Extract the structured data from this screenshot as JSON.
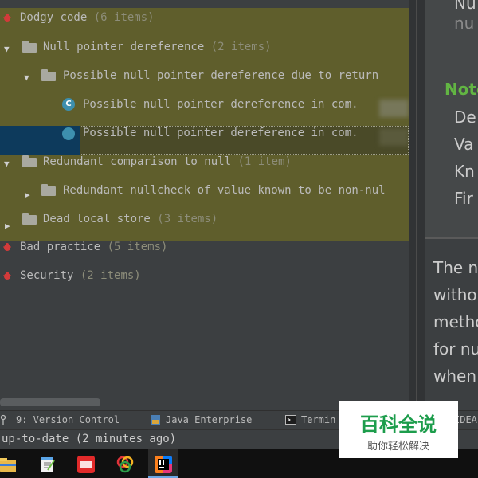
{
  "tree": {
    "rows": [
      {
        "label": "Dodgy code",
        "count": "(6 items)"
      },
      {
        "label": "Null pointer dereference",
        "count": "(2 items)"
      },
      {
        "label": "Possible null pointer dereference due to return"
      },
      {
        "label": "Possible null pointer dereference in com."
      },
      {
        "label": "Possible null pointer dereference in com."
      },
      {
        "label": "Redundant comparison to null",
        "count": "(1 item)"
      },
      {
        "label": "Redundant nullcheck of value known to be non-nul"
      },
      {
        "label": "Dead local store",
        "count": "(3 items)"
      },
      {
        "label": "Bad practice",
        "count": "(5 items)"
      },
      {
        "label": "Security",
        "count": "(2 items)"
      }
    ],
    "class_icon_letter": "C"
  },
  "details": {
    "top_lines": [
      "Nu",
      "nu"
    ],
    "notes_heading": "Note",
    "note_items": [
      "De",
      "Va",
      "Kn",
      "Fir"
    ],
    "paragraph_lines": [
      "The n",
      "witho",
      "metho",
      "for nu",
      "when"
    ]
  },
  "tool_bar": {
    "version_control": "9: Version Control",
    "java_enterprise": "Java Enterprise",
    "terminal": "Termin",
    "idea": "IDEA"
  },
  "status": {
    "text": "up-to-date (2 minutes ago)"
  },
  "watermark": {
    "main": "百科全说",
    "sub": "助你轻松解决"
  },
  "colors": {
    "highlight": "#5f5e2c",
    "selection": "#0d3a5c",
    "notes_heading": "#62b543",
    "class_icon": "#3d8fae",
    "watermark_green": "#1d9d4c"
  },
  "icons": {
    "bug": "bug-icon",
    "folder": "folder-icon",
    "class": "class-icon"
  }
}
